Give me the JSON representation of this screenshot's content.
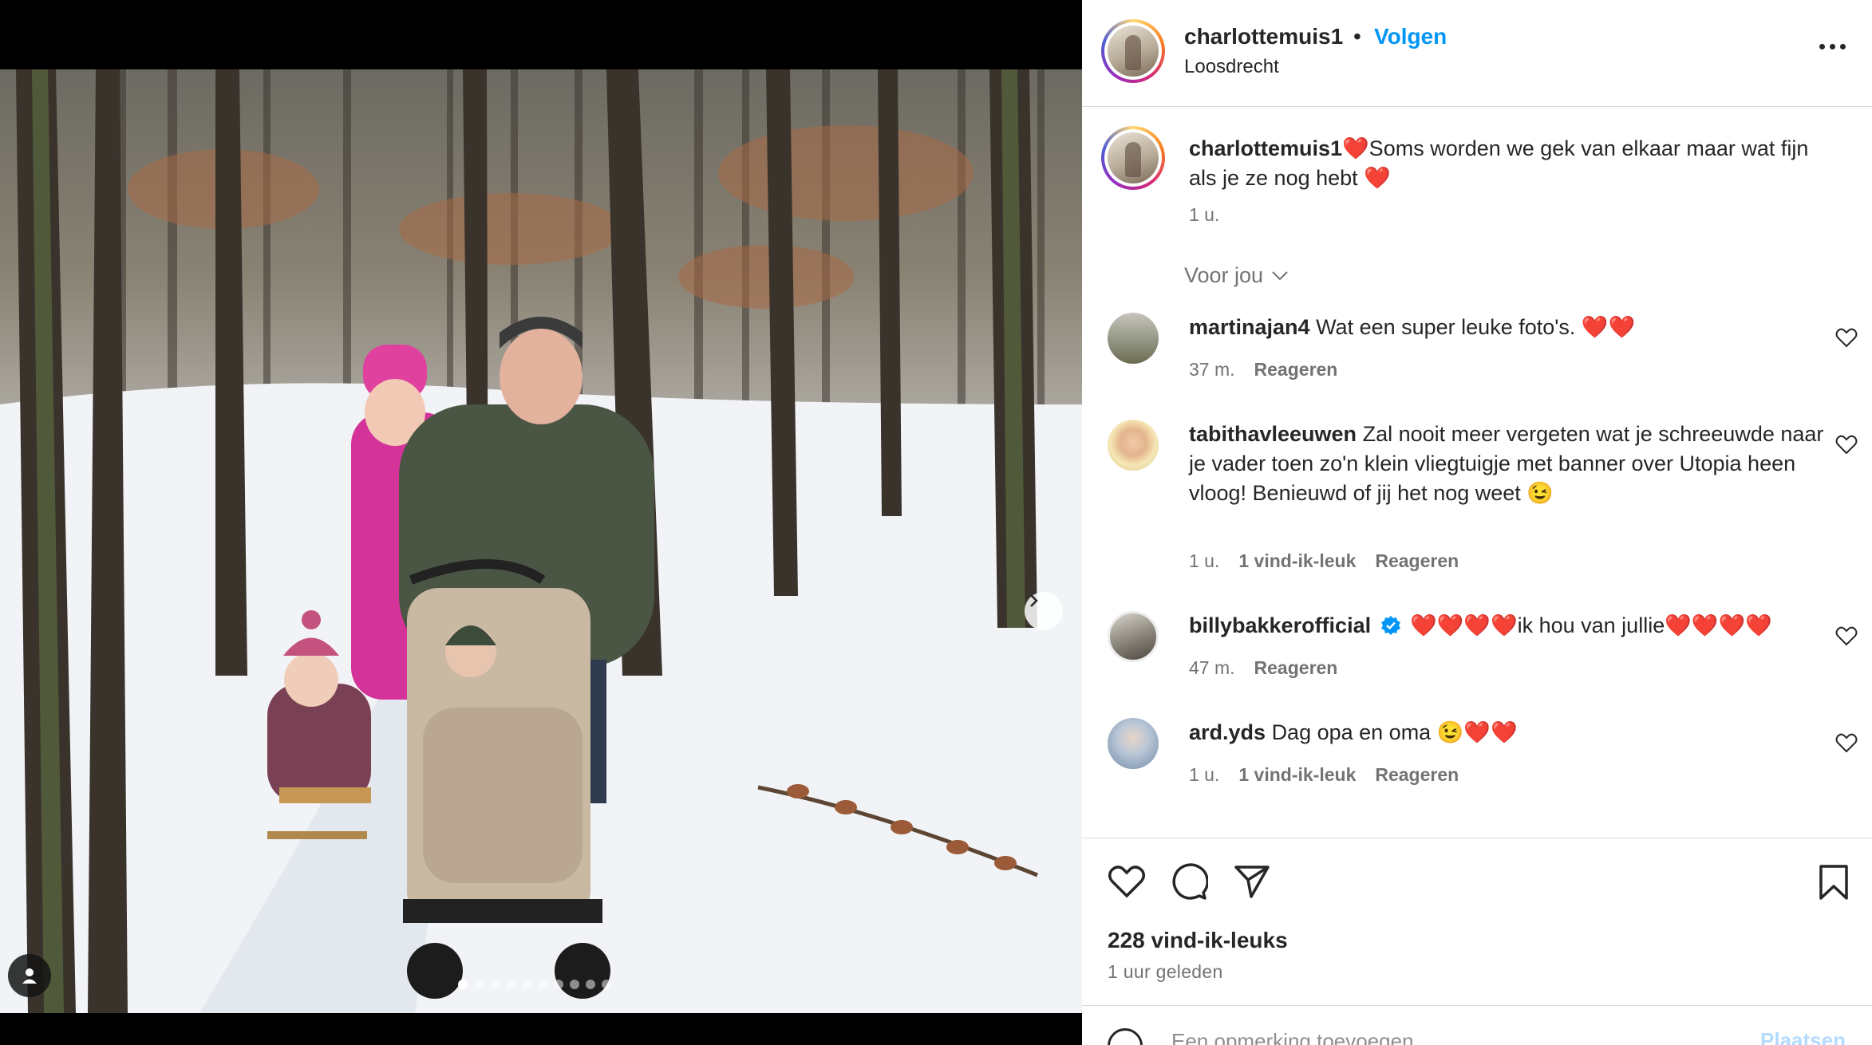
{
  "header": {
    "username": "charlottemuis1",
    "separator": "•",
    "follow_label": "Volgen",
    "location": "Loosdrecht"
  },
  "caption": {
    "username": "charlottemuis1",
    "text": "❤️Soms worden we gek van elkaar maar wat fijn als je ze nog hebt ❤️",
    "time": "1 u."
  },
  "filter": {
    "label": "Voor jou"
  },
  "comments": [
    {
      "username": "martinajan4",
      "text": "Wat een super leuke foto's. ❤️❤️",
      "time": "37 m.",
      "likes": "",
      "reply": "Reageren"
    },
    {
      "username": "tabithavleeuwen",
      "text": "Zal nooit meer vergeten wat je schreeuwde naar je vader toen zo'n klein vliegtuigje met banner over Utopia heen vloog! Benieuwd of jij het nog weet 😉",
      "time": "1 u.",
      "likes": "1 vind-ik-leuk",
      "reply": "Reageren"
    },
    {
      "username": "billybakkerofficial",
      "verified": true,
      "text": "❤️❤️❤️❤️ik hou van jullie❤️❤️❤️❤️",
      "time": "47 m.",
      "likes": "",
      "reply": "Reageren"
    },
    {
      "username": "ard.yds",
      "text": "Dag opa en oma 😉❤️❤️",
      "time": "1 u.",
      "likes": "1 vind-ik-leuk",
      "reply": "Reageren"
    }
  ],
  "footer": {
    "likes": "228 vind-ik-leuks",
    "posted": "1 uur geleden",
    "comment_placeholder": "Een opmerking toevoegen...",
    "post_label": "Plaatsen"
  },
  "carousel": {
    "count": 10,
    "active": 0
  },
  "icons": {
    "next": "chevron-right-icon",
    "tag": "user-tag-icon",
    "more": "more-options-icon",
    "like": "heart-icon",
    "comment": "comment-icon",
    "share": "share-icon",
    "save": "bookmark-icon",
    "emoji": "emoji-icon"
  },
  "colors": {
    "accent": "#0095f6",
    "heart": "#e0245e",
    "muted": "#737373"
  }
}
